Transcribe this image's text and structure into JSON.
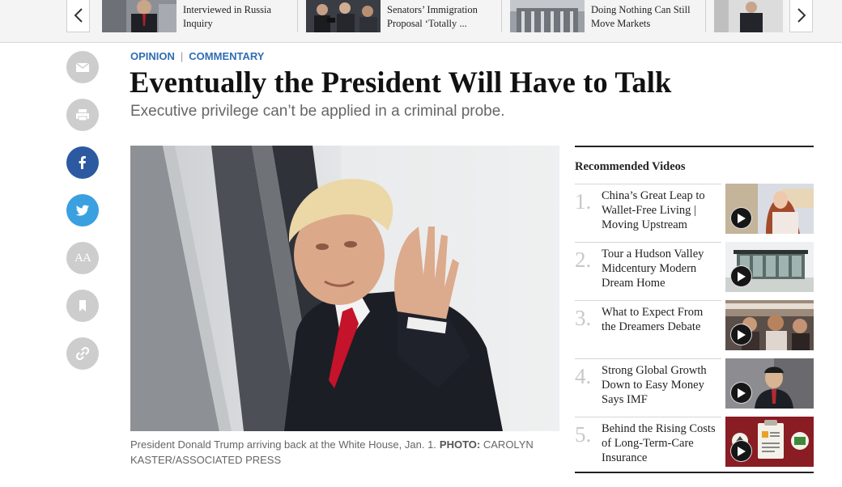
{
  "carousel": {
    "prev_icon": "chevron-left-icon",
    "next_icon": "chevron-right-icon",
    "items": [
      {
        "title": "Interviewed in Russia Inquiry"
      },
      {
        "title": "Senators’ Immigration Proposal ‘Totally ..."
      },
      {
        "title": "Doing Nothing Can Still Move Markets"
      },
      {
        "title": ""
      }
    ]
  },
  "share": {
    "buttons": [
      {
        "icon": "email-icon"
      },
      {
        "icon": "print-icon"
      },
      {
        "icon": "facebook-icon",
        "color": "#2b5aa0"
      },
      {
        "icon": "twitter-icon",
        "color": "#3aa0e0"
      },
      {
        "icon": "text-size-icon",
        "label": "AA"
      },
      {
        "icon": "bookmark-icon"
      },
      {
        "icon": "link-icon"
      }
    ]
  },
  "article": {
    "section": "OPINION",
    "subsection": "COMMENTARY",
    "headline": "Eventually the President Will Have to Talk",
    "dek": "Executive privilege can’t be applied in a criminal probe.",
    "caption": "President Donald Trump arriving back at the White House, Jan. 1.",
    "credit_label": "PHOTO:",
    "credit": "CAROLYN KASTER/ASSOCIATED PRESS"
  },
  "recommended": {
    "heading": "Recommended Videos",
    "items": [
      {
        "num": "1.",
        "title": "China’s Great Leap to Wallet-Free Living | Moving Upstream"
      },
      {
        "num": "2.",
        "title": "Tour a Hudson Valley Midcentury Modern Dream Home"
      },
      {
        "num": "3.",
        "title": "What to Expect From the Dreamers Debate"
      },
      {
        "num": "4.",
        "title": "Strong Global Growth Down to Easy Money Says IMF"
      },
      {
        "num": "5.",
        "title": "Behind the Rising Costs of Long-Term-Care Insurance"
      }
    ]
  },
  "colors": {
    "link_blue": "#2f6db5",
    "facebook": "#2b5aa0",
    "twitter": "#3aa0e0",
    "share_gray": "#cdcdcd"
  }
}
